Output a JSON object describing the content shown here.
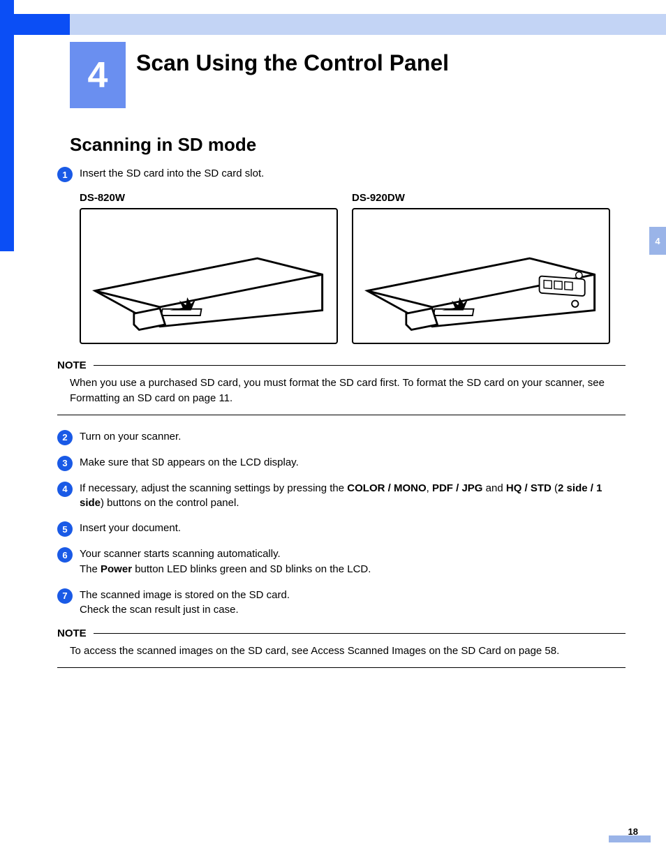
{
  "chapter": {
    "number": "4",
    "title": "Scan Using the Control Panel"
  },
  "section": {
    "title": "Scanning in SD mode"
  },
  "side_tab": "4",
  "product_labels": {
    "left": "DS-820W",
    "right": "DS-920DW"
  },
  "steps": {
    "s1": {
      "num": "1",
      "text": "Insert the SD card into the SD card slot."
    },
    "s2": {
      "num": "2",
      "text": "Turn on your scanner."
    },
    "s3": {
      "num": "3",
      "pre": "Make sure that ",
      "code": "SD",
      "post": " appears on the LCD display."
    },
    "s4": {
      "num": "4",
      "pre": "If necessary, adjust the scanning settings by pressing the ",
      "b1": "COLOR / MONO",
      "sep1": ", ",
      "b2": "PDF / JPG",
      "sep2": " and ",
      "b3": "HQ / STD",
      "line2_open": " (",
      "b4": "2 side / 1 side",
      "line2_close": ") buttons on the control panel."
    },
    "s5": {
      "num": "5",
      "text": "Insert your document."
    },
    "s6": {
      "num": "6",
      "line1": "Your scanner starts scanning automatically.",
      "line2_pre": "The ",
      "line2_b": "Power",
      "line2_mid": " button LED blinks green and ",
      "line2_code": "SD",
      "line2_post": " blinks on the LCD."
    },
    "s7": {
      "num": "7",
      "line1": "The scanned image is stored on the SD card.",
      "line2": "Check the scan result just in case."
    }
  },
  "notes": {
    "n1": {
      "label": "NOTE",
      "pre": "When you use a purchased SD card, you must format the SD card first. To format the SD card on your scanner, see ",
      "italic": "Formatting an SD card",
      "post": " on page 11."
    },
    "n2": {
      "label": "NOTE",
      "pre": "To access the scanned images on the SD card, see ",
      "italic": "Access Scanned Images on the SD Card",
      "post": " on page 58."
    }
  },
  "page_number": "18"
}
